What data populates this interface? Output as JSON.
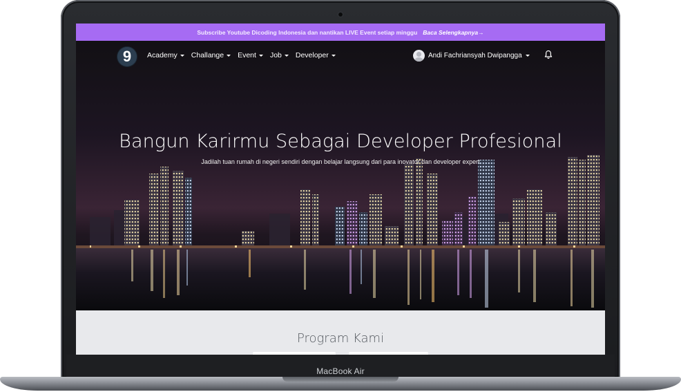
{
  "device": {
    "model": "MacBook Air"
  },
  "banner": {
    "text": "Subscribe Youtube Dicoding Indonesia dan nantikan LIVE Event setiap minggu",
    "cta": "Baca Selengkapnya→",
    "color": "#a66bf3"
  },
  "nav": {
    "logo": "9",
    "items": [
      {
        "label": "Academy"
      },
      {
        "label": "Challange"
      },
      {
        "label": "Event"
      },
      {
        "label": "Job"
      },
      {
        "label": "Developer"
      }
    ],
    "user_name": "Andi Fachriansyah Dwipangga",
    "icons": [
      "avatar-icon",
      "bell-icon",
      "caret-down-icon"
    ]
  },
  "hero": {
    "title": "Bangun Karirmu Sebagai Developer Profesional",
    "subtitle": "Jadilah tuan rumah di negeri sendiri dengan belajar langsung dari para inovator dan developer expert"
  },
  "program": {
    "title": "Program Kami"
  }
}
